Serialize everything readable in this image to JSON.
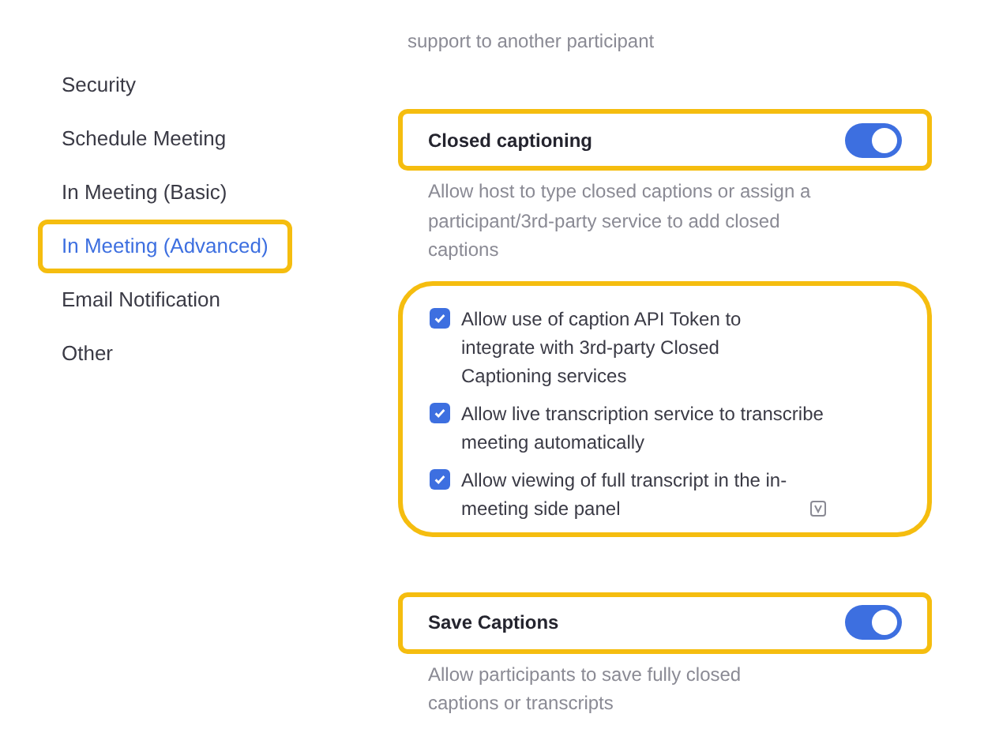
{
  "sidebar": {
    "items": [
      {
        "label": "Security",
        "selected": false,
        "highlighted": false
      },
      {
        "label": "Schedule Meeting",
        "selected": false,
        "highlighted": false
      },
      {
        "label": "In Meeting (Basic)",
        "selected": false,
        "highlighted": false
      },
      {
        "label": "In Meeting (Advanced)",
        "selected": true,
        "highlighted": true
      },
      {
        "label": "Email Notification",
        "selected": false,
        "highlighted": false
      },
      {
        "label": "Other",
        "selected": false,
        "highlighted": false
      }
    ]
  },
  "top_text": "support to another participant",
  "settings": [
    {
      "title": "Closed captioning",
      "on": true,
      "highlighted": true,
      "description": "Allow host to type closed captions or assign a participant/3rd-party service to add closed captions",
      "options": [
        {
          "label": "Allow use of caption API Token to integrate with 3rd-party Closed Captioning services",
          "checked": true,
          "info_icon": false
        },
        {
          "label": "Allow live transcription service to transcribe meeting automatically",
          "checked": true,
          "info_icon": false
        },
        {
          "label": "Allow viewing of full transcript in the in-meeting side panel",
          "checked": true,
          "info_icon": true
        }
      ],
      "options_highlighted": true
    },
    {
      "title": "Save Captions",
      "on": true,
      "highlighted": true,
      "description": "Allow participants to save fully closed captions or transcripts"
    }
  ]
}
